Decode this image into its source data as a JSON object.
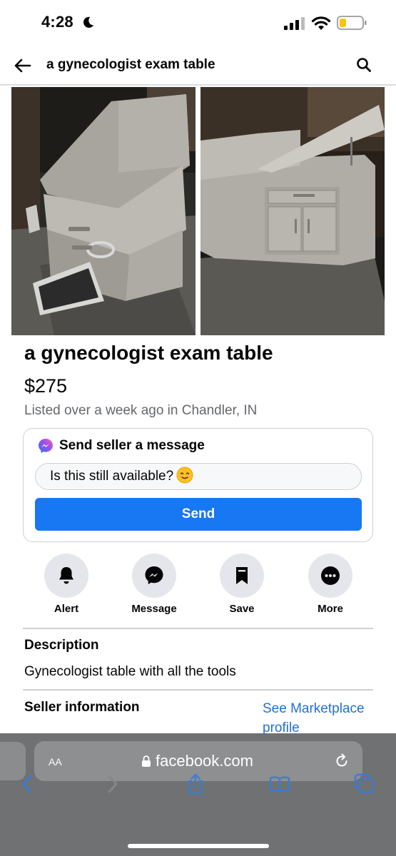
{
  "status_bar": {
    "time": "4:28",
    "icons": [
      "moon-icon",
      "cellular-signal-icon",
      "wifi-icon",
      "battery-low-icon"
    ]
  },
  "header": {
    "title": "a gynecologist exam table",
    "back_icon": "back-arrow-icon",
    "search_icon": "search-icon"
  },
  "listing": {
    "title": "a gynecologist exam table",
    "price": "$275",
    "meta": "Listed over a week ago in Chandler, IN"
  },
  "message": {
    "heading": "Send seller a message",
    "input_value": "Is this still available?",
    "emoji": "smiling-face-emoji",
    "send_label": "Send"
  },
  "actions": [
    {
      "label": "Alert",
      "icon": "bell-icon"
    },
    {
      "label": "Message",
      "icon": "messenger-icon"
    },
    {
      "label": "Save",
      "icon": "bookmark-icon"
    },
    {
      "label": "More",
      "icon": "more-icon"
    }
  ],
  "description": {
    "heading": "Description",
    "text": "Gynecologist table with all the tools"
  },
  "seller": {
    "heading": "Seller information",
    "link": "See Marketplace profile"
  },
  "browser": {
    "text_size_label": "AA",
    "url": "facebook.com",
    "toolbar_icons": [
      "back-icon",
      "forward-icon",
      "share-icon",
      "bookmarks-icon",
      "tabs-icon"
    ]
  },
  "colors": {
    "accent": "#1877f2",
    "link": "#216fdb",
    "secondary_text": "#65676b",
    "browser_bar": "#6f7173"
  }
}
